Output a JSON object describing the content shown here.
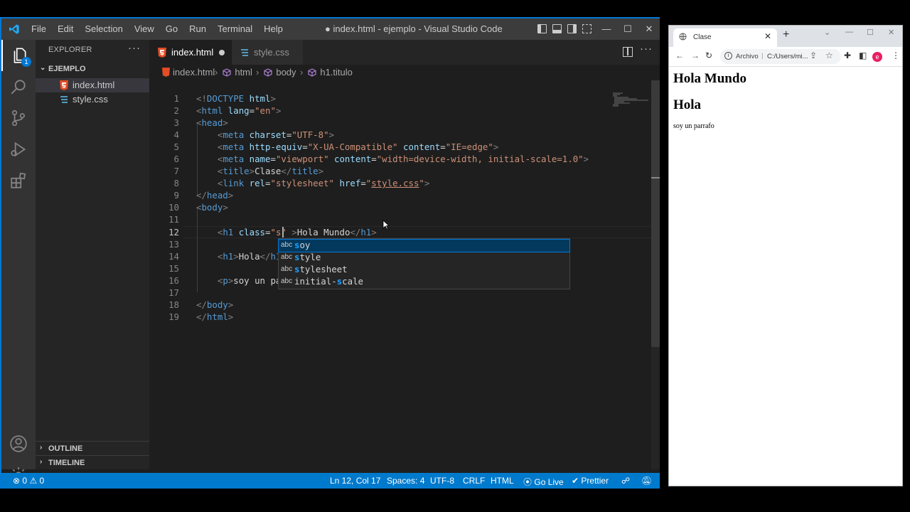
{
  "vscode": {
    "menu": [
      "File",
      "Edit",
      "Selection",
      "View",
      "Go",
      "Run",
      "Terminal",
      "Help"
    ],
    "window_title": "● index.html - ejemplo - Visual Studio Code",
    "window_controls": {
      "minimize": "—",
      "maximize": "☐",
      "close": "✕"
    },
    "activity_badge": "1",
    "explorer": {
      "header": "EXPLORER",
      "more": "···",
      "folder": "EJEMPLO",
      "files": [
        "index.html",
        "style.css"
      ],
      "outline": "OUTLINE",
      "timeline": "TIMELINE"
    },
    "tabs": [
      {
        "label": "index.html",
        "modified": true
      },
      {
        "label": "style.css",
        "modified": false
      }
    ],
    "breadcrumb": [
      "index.html",
      "html",
      "body",
      "h1.titulo"
    ],
    "line_numbers": [
      "1",
      "2",
      "3",
      "4",
      "5",
      "6",
      "7",
      "8",
      "9",
      "10",
      "11",
      "12",
      "13",
      "14",
      "15",
      "16",
      "17",
      "18",
      "19"
    ],
    "current_line": "12",
    "suggestions": [
      {
        "kind": "abc",
        "match": "s",
        "rest": "oy",
        "full": "soy"
      },
      {
        "kind": "abc",
        "match": "s",
        "rest": "tyle",
        "full": "style"
      },
      {
        "kind": "abc",
        "match": "s",
        "rest": "tylesheet",
        "full": "stylesheet"
      },
      {
        "kind": "abc",
        "pre": "initial-",
        "match": "s",
        "rest": "cale",
        "full": "initial-scale"
      }
    ],
    "status": {
      "errors": "0",
      "warnings": "0",
      "position": "Ln 12, Col 17",
      "spaces": "Spaces: 4",
      "encoding": "UTF-8",
      "eol": "CRLF",
      "language": "HTML",
      "golive": "Go Live",
      "prettier": "Prettier"
    }
  },
  "browser": {
    "tab_title": "Clase",
    "tab_close": "✕",
    "new_tab": "+",
    "omnibox": {
      "label": "Archivo",
      "url": "C:/Users/mi..."
    },
    "avatar": "e",
    "page": {
      "h1_first": "Hola Mundo",
      "h1_second": "Hola",
      "paragraph": "soy un parrafo"
    }
  },
  "colors": {
    "accent": "#007acc",
    "html_icon": "#e44d26",
    "css_icon": "#519aba",
    "suggest_highlight": "#18a3ff"
  }
}
